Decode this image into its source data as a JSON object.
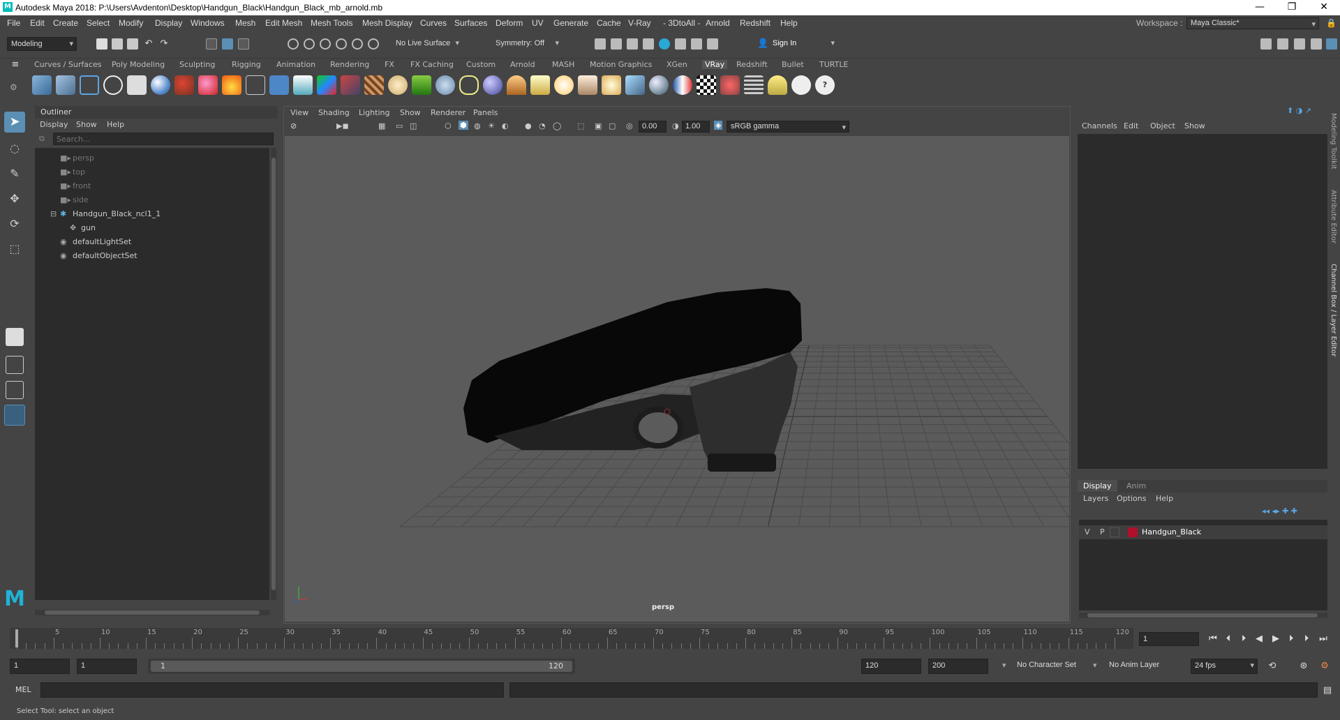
{
  "window": {
    "title": "Autodesk Maya 2018: P:\\Users\\Avdenton\\Desktop\\Handgun_Black\\Handgun_Black_mb_arnold.mb",
    "logo": "M"
  },
  "menubar": {
    "items": [
      "File",
      "Edit",
      "Create",
      "Select",
      "Modify",
      "Display",
      "Windows",
      "Mesh",
      "Edit Mesh",
      "Mesh Tools",
      "Mesh Display",
      "Curves",
      "Surfaces",
      "Deform",
      "UV",
      "Generate",
      "Cache",
      "V-Ray",
      "- 3DtoAll -",
      "Arnold",
      "Redshift",
      "Help"
    ],
    "workspace_label": "Workspace :",
    "workspace_value": "Maya Classic*"
  },
  "statusline": {
    "mode": "Modeling",
    "live_surface": "No Live Surface",
    "symmetry": "Symmetry: Off",
    "sign_in": "Sign In"
  },
  "shelf": {
    "tabs": [
      "Curves / Surfaces",
      "Poly Modeling",
      "Sculpting",
      "Rigging",
      "Animation",
      "Rendering",
      "FX",
      "FX Caching",
      "Custom",
      "Arnold",
      "MASH",
      "Motion Graphics",
      "XGen",
      "VRay",
      "Redshift",
      "Bullet",
      "TURTLE"
    ],
    "active_tab": "VRay"
  },
  "outliner": {
    "title": "Outliner",
    "menu": [
      "Display",
      "Show",
      "Help"
    ],
    "search_placeholder": "Search...",
    "items": [
      {
        "label": "persp",
        "dim": true
      },
      {
        "label": "top",
        "dim": true
      },
      {
        "label": "front",
        "dim": true
      },
      {
        "label": "side",
        "dim": true
      },
      {
        "label": "Handgun_Black_ncl1_1",
        "dim": false
      },
      {
        "label": "gun",
        "dim": false
      },
      {
        "label": "defaultLightSet",
        "dim": false
      },
      {
        "label": "defaultObjectSet",
        "dim": false
      }
    ]
  },
  "viewport": {
    "menu": [
      "View",
      "Shading",
      "Lighting",
      "Show",
      "Renderer",
      "Panels"
    ],
    "exposure": "0.00",
    "gamma": "1.00",
    "color_space": "sRGB gamma",
    "camera_label": "persp"
  },
  "channelbox": {
    "menu": [
      "Channels",
      "Edit",
      "Object",
      "Show"
    ]
  },
  "layers": {
    "tabs": [
      "Display",
      "Anim"
    ],
    "menu": [
      "Layers",
      "Options",
      "Help"
    ],
    "layer": {
      "v": "V",
      "p": "P",
      "name": "Handgun_Black",
      "color": "#b0102c"
    }
  },
  "sidetabs": [
    "Modeling Toolkit",
    "Attribute Editor",
    "Channel Box / Layer Editor"
  ],
  "timeline": {
    "ticks": [
      "5",
      "10",
      "15",
      "20",
      "25",
      "30",
      "35",
      "40",
      "45",
      "50",
      "55",
      "60",
      "65",
      "70",
      "75",
      "80",
      "85",
      "90",
      "95",
      "100",
      "105",
      "110",
      "115",
      "120"
    ],
    "current_frame": "1"
  },
  "range": {
    "start": "1",
    "playback_start": "1",
    "slider_start": "1",
    "slider_end": "120",
    "playback_end": "120",
    "end": "200",
    "character_set": "No Character Set",
    "anim_layer": "No Anim Layer",
    "fps": "24 fps"
  },
  "cmdline": {
    "lang": "MEL"
  },
  "helpline": {
    "text": "Select Tool: select an object"
  }
}
